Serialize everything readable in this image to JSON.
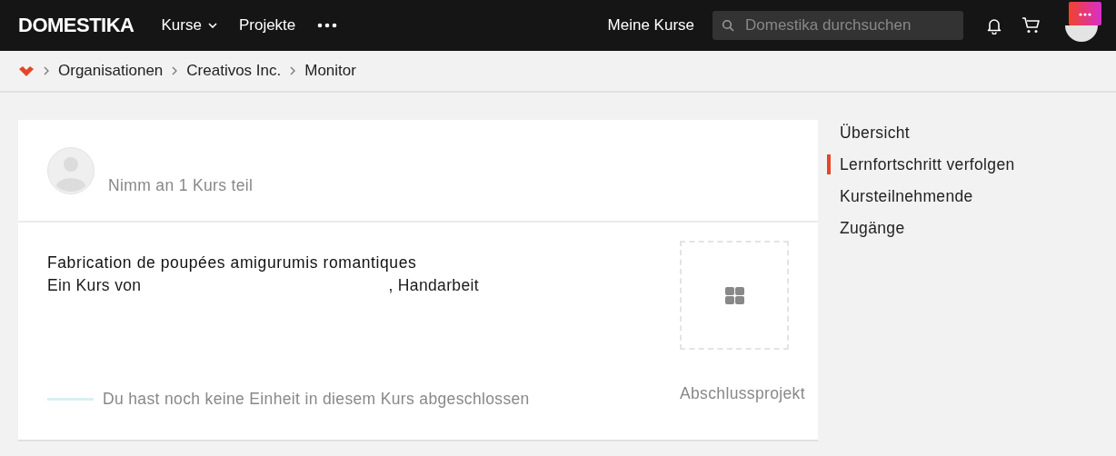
{
  "header": {
    "logo": "DOMESTIKA",
    "nav": [
      {
        "label": "Kurse",
        "kind": "dropdown"
      },
      {
        "label": "Projekte",
        "kind": "link"
      },
      {
        "kind": "more"
      }
    ],
    "my_courses": "Meine Kurse",
    "search": {
      "placeholder": "Domestika durchsuchen"
    }
  },
  "breadcrumb": [
    "Organisationen",
    "Creativos Inc.",
    "Monitor"
  ],
  "member": {
    "summary": "Nimm an 1 Kurs teil"
  },
  "course": {
    "title": "Fabrication de poupées amigurumis romantiques",
    "byline_start": "Ein Kurs von",
    "byline_end": ", Handarbeit",
    "progress": {
      "level": 0
    },
    "progress_text": "Du hast noch keine Einheit in diesem Kurs abgeschlossen",
    "final_project": "Abschlussprojekt"
  },
  "sidebar": {
    "items": [
      {
        "label": "Übersicht",
        "selected": false
      },
      {
        "label": "Lernfortschritt verfolgen",
        "selected": true
      },
      {
        "label": "Kursteilnehmende",
        "selected": false
      },
      {
        "label": "Zugänge",
        "selected": false
      }
    ]
  }
}
